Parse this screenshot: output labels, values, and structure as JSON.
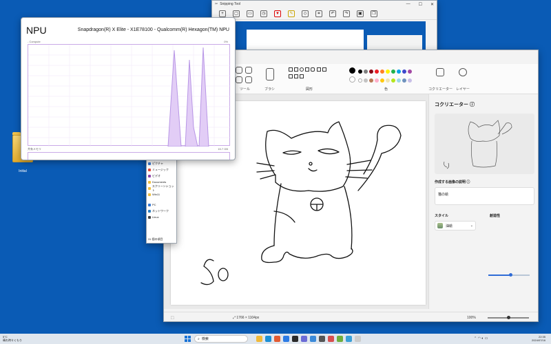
{
  "npu": {
    "title": "NPU",
    "model": "Snapdragon(R) X Elite - X1E78100 - Qualcomm(R) Hexagon(TM) NPU",
    "subtitle": "- Compute",
    "percent": "0%",
    "memory_label": "共有メモリ",
    "memory_value": "15.7 GB"
  },
  "snipping_tool": {
    "title": "Snipping Tool"
  },
  "paint": {
    "ribbon": {
      "tools_label": "ツール",
      "brush_label": "ブラシ",
      "shapes_label": "図形",
      "colors_label": "色",
      "cocreator_label": "コクリエーター",
      "layers_label": "レイヤー"
    },
    "canvas_text": "50",
    "status": {
      "dimensions": "1766 × 1104px",
      "zoom": "100%"
    }
  },
  "cocreator": {
    "title": "コクリエーター",
    "desc_label": "作成する画像の説明",
    "desc_value": "猫の絵",
    "style_label": "スタイル",
    "style_value": "油絵",
    "creativity_label": "創造性"
  },
  "explorer": {
    "items": [
      "ピクチャ",
      "ミュージック",
      "ビデオ",
      "Documents",
      "スクリーンショット",
      "Win11",
      "PC",
      "ネットワーク",
      "Linux"
    ],
    "footer": "31 個の項目"
  },
  "desktop": {
    "icon_label": "Initial"
  },
  "taskbar": {
    "weather_temp": "5°C",
    "weather_desc": "晴れ時々くもり",
    "search_placeholder": "検索",
    "time": "22:35",
    "date": "2024/07/16"
  },
  "colors": {
    "desktop": "#0a5bb5",
    "npu_line": "#b896e6",
    "palette": [
      "#000000",
      "#7f7f7f",
      "#880015",
      "#ed1c24",
      "#ff7f27",
      "#fff200",
      "#22b14c",
      "#00a2e8",
      "#3f48cc",
      "#a349a4",
      "#ffffff",
      "#c3c3c3",
      "#b97a57",
      "#ffaec9",
      "#ffc90e",
      "#efe4b0",
      "#b5e61d",
      "#99d9ea",
      "#7092be",
      "#c8bfe7"
    ]
  }
}
